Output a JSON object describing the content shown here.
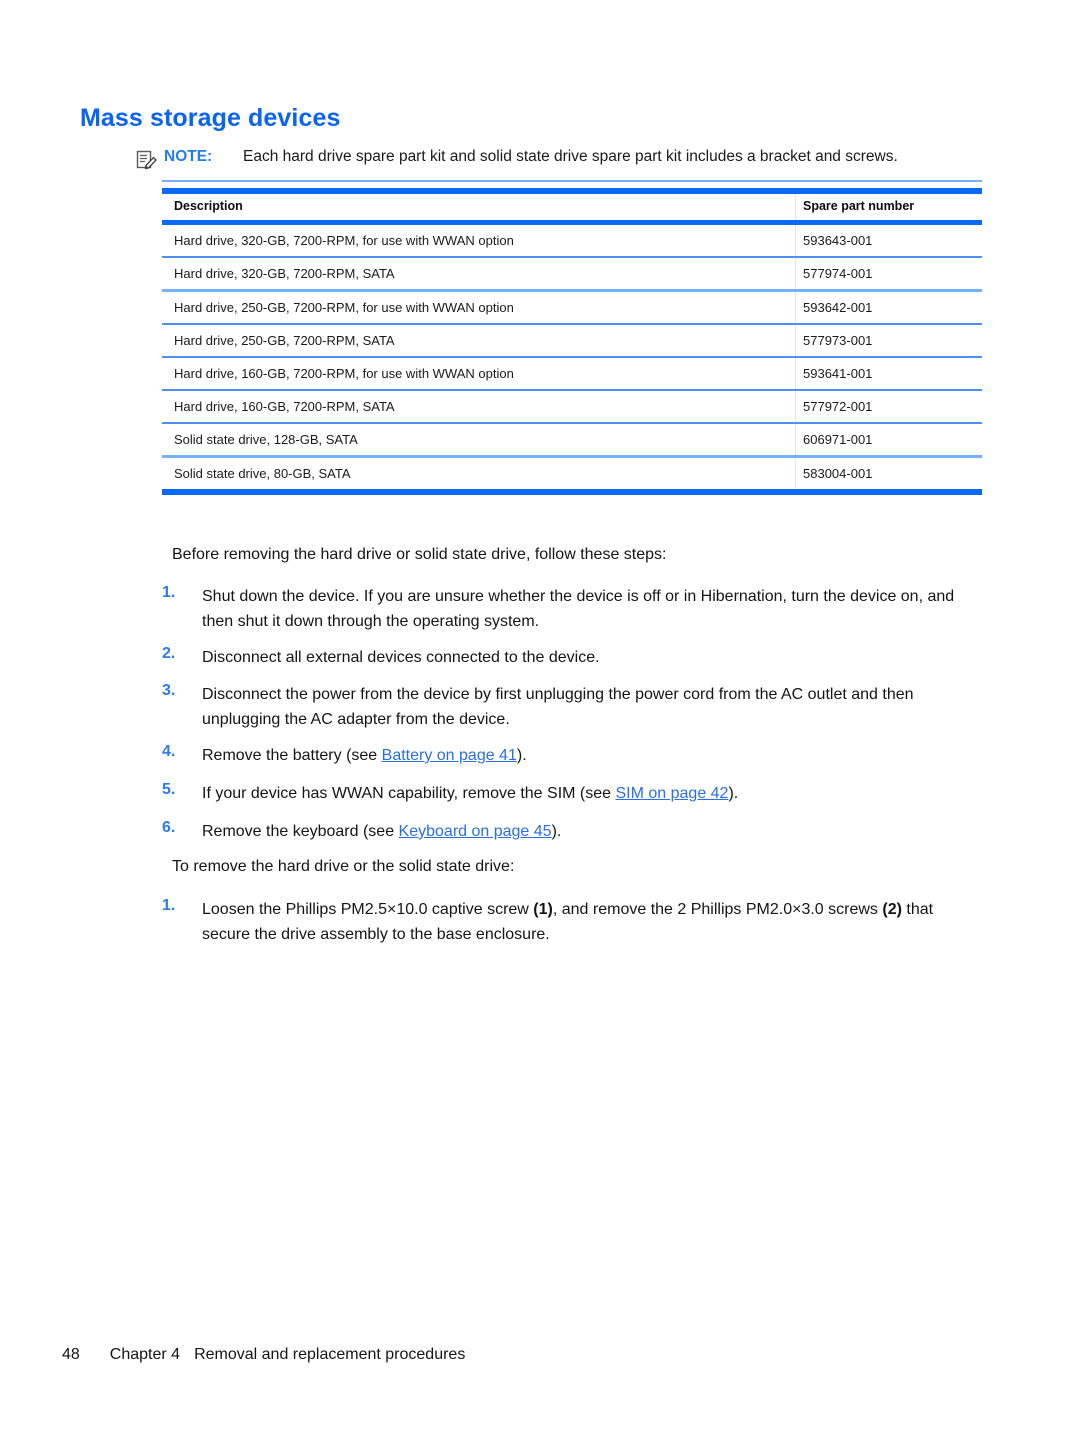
{
  "document": {
    "title": "Mass storage devices"
  },
  "note": {
    "icon": "note-pencil-icon",
    "label": "NOTE:",
    "text": "Each hard drive spare part kit and solid state drive spare part kit includes a bracket and screws."
  },
  "table": {
    "columns": [
      "Description",
      "Spare part number"
    ],
    "rows": [
      {
        "description": "Hard drive, 320-GB, 7200-RPM, for use with WWAN option",
        "part": "593643-001"
      },
      {
        "description": "Hard drive, 320-GB, 7200-RPM, SATA",
        "part": "577974-001"
      },
      {
        "description": "Hard drive, 250-GB, 7200-RPM, for use with WWAN option",
        "part": "593642-001"
      },
      {
        "description": "Hard drive, 250-GB, 7200-RPM, SATA",
        "part": "577973-001"
      },
      {
        "description": "Hard drive, 160-GB, 7200-RPM, for use with WWAN option",
        "part": "593641-001"
      },
      {
        "description": "Hard drive, 160-GB, 7200-RPM, SATA",
        "part": "577972-001"
      },
      {
        "description": "Solid state drive, 128-GB, SATA",
        "part": "606971-001"
      },
      {
        "description": "Solid state drive, 80-GB, SATA",
        "part": "583004-001"
      }
    ]
  },
  "intro": {
    "before_steps": "Before removing the hard drive or solid state drive, follow these steps:"
  },
  "prep_steps": [
    {
      "number": "1.",
      "text": "Shut down the device. If you are unsure whether the device is off or in Hibernation, turn the device on, and then shut it down through the operating system."
    },
    {
      "number": "2.",
      "text": "Disconnect all external devices connected to the device."
    },
    {
      "number": "3.",
      "text": "Disconnect the power from the device by first unplugging the power cord from the AC outlet and then unplugging the AC adapter from the device."
    },
    {
      "number": "4.",
      "prefix": "Remove the battery (see ",
      "link": "Battery on page 41",
      "suffix": ")."
    },
    {
      "number": "5.",
      "prefix": "If your device has WWAN capability, remove the SIM (see ",
      "link": "SIM on page 42",
      "suffix": ")."
    },
    {
      "number": "6.",
      "prefix": "Remove the keyboard (see ",
      "link": "Keyboard on page 45",
      "suffix": ")."
    }
  ],
  "removal": {
    "intro": "To remove the hard drive or the solid state drive:",
    "step_number": "1.",
    "part_a": "Loosen the Phillips PM2.5×10.0 captive screw ",
    "ref_1": "(1)",
    "part_b": ", and remove the 2 Phillips PM2.0×3.0 screws ",
    "ref_2": "(2)",
    "part_c": " that secure the drive assembly to the base enclosure."
  },
  "footer": {
    "page_number": "48",
    "chapter": "Chapter 4",
    "chapter_title": "Removal and replacement procedures"
  },
  "colors": {
    "heading_blue": "#0a64f0",
    "rule_blue": "#0a6af5",
    "light_rule_blue": "#76b2f7",
    "link_blue": "#2a6fe0"
  }
}
